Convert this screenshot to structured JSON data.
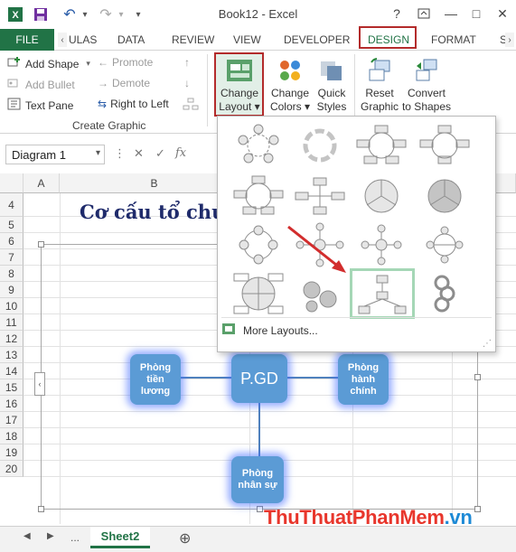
{
  "window": {
    "title": "Book12 - Excel",
    "help": "?",
    "restore": "⧉",
    "minimize": "—",
    "maximize": "□",
    "close": "✕",
    "save_icon": "💾",
    "undo_icon": "↶",
    "redo_icon": "↷",
    "qat_more": "▾"
  },
  "tabs": {
    "file": "FILE",
    "items": [
      "ULAS",
      "DATA",
      "REVIEW",
      "VIEW",
      "DEVELOPER",
      "DESIGN",
      "FORMAT",
      "S"
    ],
    "scroll_left": "‹",
    "scroll_right": "›"
  },
  "ribbon": {
    "add_shape": "Add Shape",
    "add_bullet": "Add Bullet",
    "text_pane": "Text Pane",
    "promote": "Promote",
    "demote": "Demote",
    "right_to_left": "Right to Left",
    "create_graphic": "Create Graphic",
    "change_layout_1": "Change",
    "change_layout_2": "Layout",
    "change_colors_1": "Change",
    "change_colors_2": "Colors",
    "quick_styles_1": "Quick",
    "quick_styles_2": "Styles",
    "reset_graphic_1": "Reset",
    "reset_graphic_2": "Graphic",
    "convert_1": "Convert",
    "convert_2": "to Shapes"
  },
  "formula_bar": {
    "name_box": "Diagram 1",
    "fx": "fx"
  },
  "grid": {
    "columns": [
      "A",
      "B"
    ],
    "rows": [
      "4",
      "5",
      "6",
      "7",
      "8",
      "9",
      "10",
      "11",
      "12",
      "13",
      "14",
      "15",
      "16",
      "17",
      "18",
      "19",
      "20"
    ],
    "heading": "Cơ cấu tổ chứ"
  },
  "smartart": {
    "center": "P.GD",
    "left": "Phòng tiền lương",
    "right": "Phòng hành chính",
    "bottom": "Phòng nhân sự",
    "pane_toggle": "‹"
  },
  "dropdown": {
    "more_layouts": "More Layouts...",
    "resize_grip": "⋰"
  },
  "sheets": {
    "active": "Sheet2",
    "ellipsis": "...",
    "add": "⊕",
    "prev": "◀",
    "next": "▶"
  },
  "watermark": {
    "part1": "ThuThuat",
    "part2": "PhanMem",
    "part3": ".vn"
  },
  "colors": {
    "excel_green": "#217346",
    "node_blue": "#5b9bd5",
    "highlight_red": "#b32b2b",
    "selection_green": "#a5d7b6"
  }
}
